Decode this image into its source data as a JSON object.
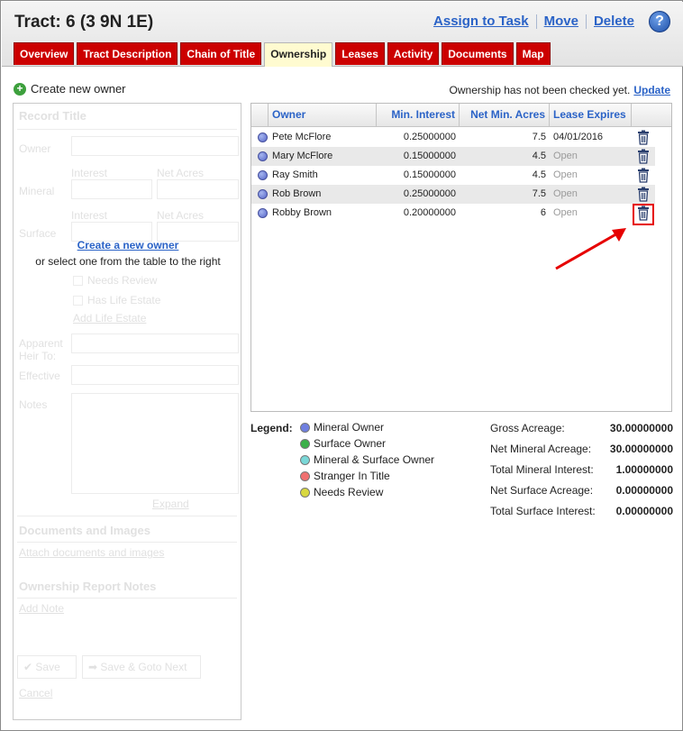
{
  "header": {
    "title": "Tract: 6 (3 9N 1E)",
    "links": [
      "Assign to Task",
      "Move",
      "Delete"
    ],
    "help_icon": "help-icon",
    "help_label": "?"
  },
  "tabs": [
    {
      "label": "Overview",
      "active": false
    },
    {
      "label": "Tract Description",
      "active": false
    },
    {
      "label": "Chain of Title",
      "active": false
    },
    {
      "label": "Ownership",
      "active": true
    },
    {
      "label": "Leases",
      "active": false
    },
    {
      "label": "Activity",
      "active": false
    },
    {
      "label": "Documents",
      "active": false
    },
    {
      "label": "Map",
      "active": false
    }
  ],
  "create_owner": {
    "label": "Create new owner",
    "icon": "plus-circle-icon"
  },
  "status": {
    "text": "Ownership has not been checked yet.",
    "update_label": "Update"
  },
  "form": {
    "section_title": "Record Title",
    "owner_label": "Owner",
    "interest_label": "Interest",
    "net_acres_label": "Net Acres",
    "mineral_label": "Mineral",
    "surface_label": "Surface",
    "create_link": "Create a new owner",
    "select_text": "or select one from the table to the right",
    "needs_review": "Needs Review",
    "has_life_estate": "Has Life Estate",
    "add_life_estate": "Add Life Estate",
    "apparent_heir": "Apparent Heir To:",
    "effective": "Effective",
    "notes": "Notes",
    "expand": "Expand",
    "docs_title": "Documents and Images",
    "attach_docs": "Attach documents and images",
    "report_title": "Ownership Report Notes",
    "add_note": "Add Note",
    "save": "Save",
    "save_next": "Save & Goto Next",
    "cancel": "Cancel"
  },
  "table": {
    "columns": [
      "Owner",
      "Min. Interest",
      "Net Min. Acres",
      "Lease Expires"
    ],
    "rows": [
      {
        "owner": "Pete McFlore",
        "min_interest": "0.25000000",
        "net_min_acres": "7.5",
        "lease_expires": "04/01/2016"
      },
      {
        "owner": "Mary McFlore",
        "min_interest": "0.15000000",
        "net_min_acres": "4.5",
        "lease_expires": "Open"
      },
      {
        "owner": "Ray Smith",
        "min_interest": "0.15000000",
        "net_min_acres": "4.5",
        "lease_expires": "Open"
      },
      {
        "owner": "Rob Brown",
        "min_interest": "0.25000000",
        "net_min_acres": "7.5",
        "lease_expires": "Open"
      },
      {
        "owner": "Robby Brown",
        "min_interest": "0.20000000",
        "net_min_acres": "6",
        "lease_expires": "Open"
      }
    ]
  },
  "legend": {
    "title": "Legend:",
    "items": [
      {
        "label": "Mineral Owner",
        "color": "#6f7fe0"
      },
      {
        "label": "Surface Owner",
        "color": "#3cb04a"
      },
      {
        "label": "Mineral & Surface Owner",
        "color": "#7ad8d8"
      },
      {
        "label": "Stranger In Title",
        "color": "#f07070"
      },
      {
        "label": "Needs Review",
        "color": "#d8d840"
      }
    ]
  },
  "stats": [
    {
      "label": "Gross Acreage:",
      "value": "30.00000000"
    },
    {
      "label": "Net Mineral Acreage:",
      "value": "30.00000000"
    },
    {
      "label": "Total Mineral Interest:",
      "value": "1.00000000"
    },
    {
      "label": "Net Surface Acreage:",
      "value": "0.00000000"
    },
    {
      "label": "Total Surface Interest:",
      "value": "0.00000000"
    }
  ],
  "colors": {
    "tab_red": "#cc0000",
    "link_blue": "#2b63c7",
    "highlight_red": "#e60000"
  }
}
